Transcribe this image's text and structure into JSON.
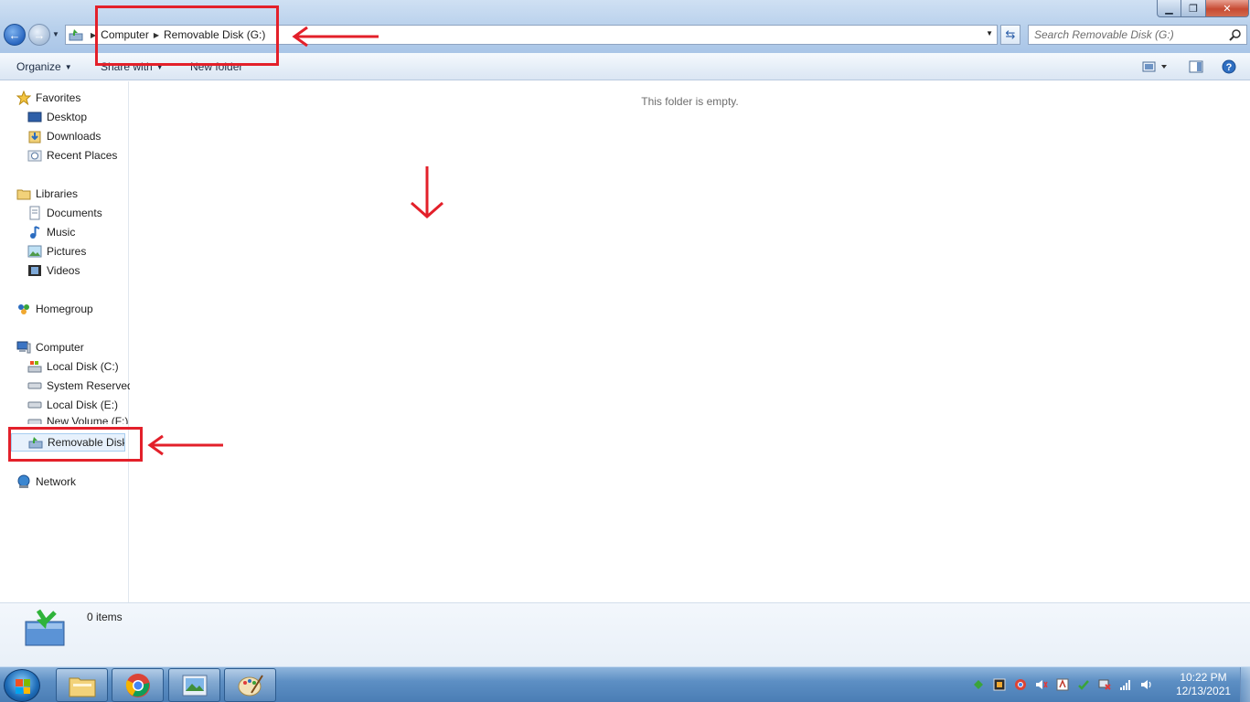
{
  "window": {
    "minimize": "▁",
    "maximize": "❐",
    "close": "✕"
  },
  "address": {
    "crumbs": [
      "Computer",
      "Removable Disk (G:)"
    ]
  },
  "search": {
    "placeholder": "Search Removable Disk (G:)"
  },
  "toolbar": {
    "organize": "Organize",
    "share_with": "Share with",
    "new_folder": "New folder"
  },
  "nav": {
    "favorites": {
      "label": "Favorites",
      "items": [
        "Desktop",
        "Downloads",
        "Recent Places"
      ]
    },
    "libraries": {
      "label": "Libraries",
      "items": [
        "Documents",
        "Music",
        "Pictures",
        "Videos"
      ]
    },
    "homegroup": {
      "label": "Homegroup"
    },
    "computer": {
      "label": "Computer",
      "items": [
        "Local Disk (C:)",
        "System Reserved",
        "Local Disk (E:)",
        "New Volume (F:)",
        "Removable Disk"
      ]
    },
    "network": {
      "label": "Network"
    }
  },
  "content": {
    "empty_message": "This folder is empty."
  },
  "details": {
    "count": "0 items"
  },
  "taskbar": {
    "clock_time": "10:22 PM",
    "clock_date": "12/13/2021"
  },
  "colors": {
    "annotation_red": "#e3202a",
    "title_gradient_top": "#cfe0f3",
    "taskbar_blue": "#4a7db5"
  },
  "icons": [
    "back-arrow-icon",
    "forward-arrow-icon",
    "removable-disk-icon",
    "refresh-icon",
    "search-icon",
    "view-options-icon",
    "preview-pane-icon",
    "help-icon",
    "star-icon",
    "desktop-icon",
    "downloads-icon",
    "recent-places-icon",
    "libraries-icon",
    "documents-icon",
    "music-icon",
    "pictures-icon",
    "videos-icon",
    "homegroup-icon",
    "computer-icon",
    "hard-disk-icon",
    "network-icon",
    "windows-logo-icon",
    "explorer-icon",
    "chrome-icon",
    "photo-viewer-icon",
    "paint-icon"
  ]
}
